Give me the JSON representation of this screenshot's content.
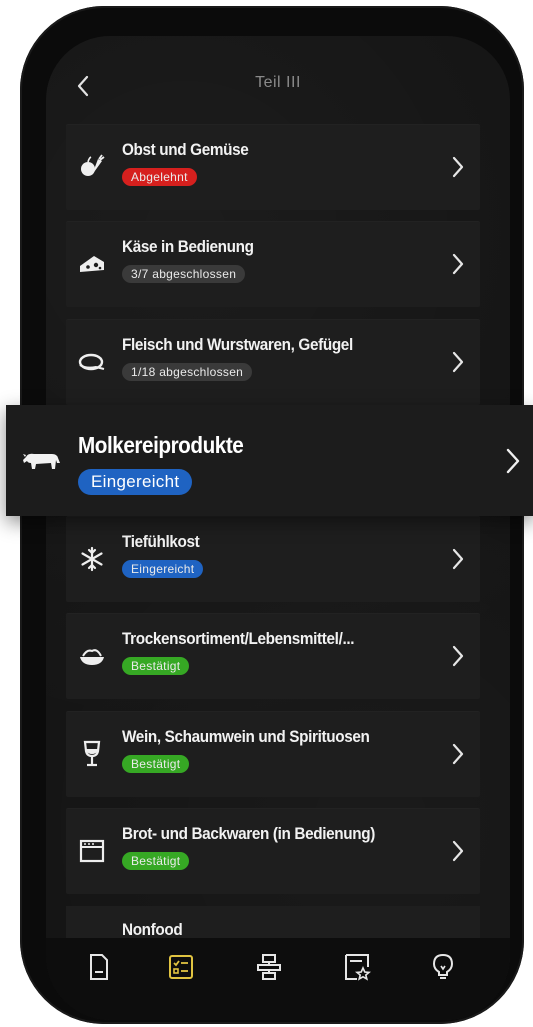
{
  "header": {
    "title": "Teil III"
  },
  "items": [
    {
      "label": "Obst und Gemüse",
      "status": "Abgelehnt",
      "status_kind": "red",
      "icon": "carrot-apple-icon"
    },
    {
      "label": "Käse in Bedienung",
      "status": "3/7 abgeschlossen",
      "status_kind": "grey",
      "icon": "cheese-icon"
    },
    {
      "label": "Fleisch und Wurstwaren, Gefügel",
      "status": "1/18 abgeschlossen",
      "status_kind": "grey",
      "icon": "meat-icon"
    },
    {
      "label": "Molkereiprodukte",
      "status": "Eingereicht",
      "status_kind": "blue",
      "icon": "cow-icon"
    },
    {
      "label": "Tiefühlkost",
      "status": "Eingereicht",
      "status_kind": "blue",
      "icon": "snowflake-icon"
    },
    {
      "label": "Trockensortiment/Lebensmittel/...",
      "status": "Bestätigt",
      "status_kind": "green",
      "icon": "noodle-bowl-icon"
    },
    {
      "label": "Wein, Schaumwein und Spirituosen",
      "status": "Bestätigt",
      "status_kind": "green",
      "icon": "wine-glass-icon"
    },
    {
      "label": "Brot- und Backwaren (in Bedienung)",
      "status": "Bestätigt",
      "status_kind": "green",
      "icon": "oven-icon"
    },
    {
      "label": "Nonfood",
      "status": "",
      "status_kind": "",
      "icon": ""
    }
  ],
  "tabbar": {
    "tabs": [
      {
        "icon": "document-icon",
        "active": false
      },
      {
        "icon": "checklist-icon",
        "active": true
      },
      {
        "icon": "structure-icon",
        "active": false
      },
      {
        "icon": "starred-document-icon",
        "active": false
      },
      {
        "icon": "lightbulb-icon",
        "active": false
      }
    ],
    "active_color": "#e0c341",
    "inactive_color": "#e6e6e6"
  },
  "colors": {
    "red": "#d6201e",
    "grey": "#3a3a3a",
    "blue": "#1f63c2",
    "green": "#36a824"
  }
}
